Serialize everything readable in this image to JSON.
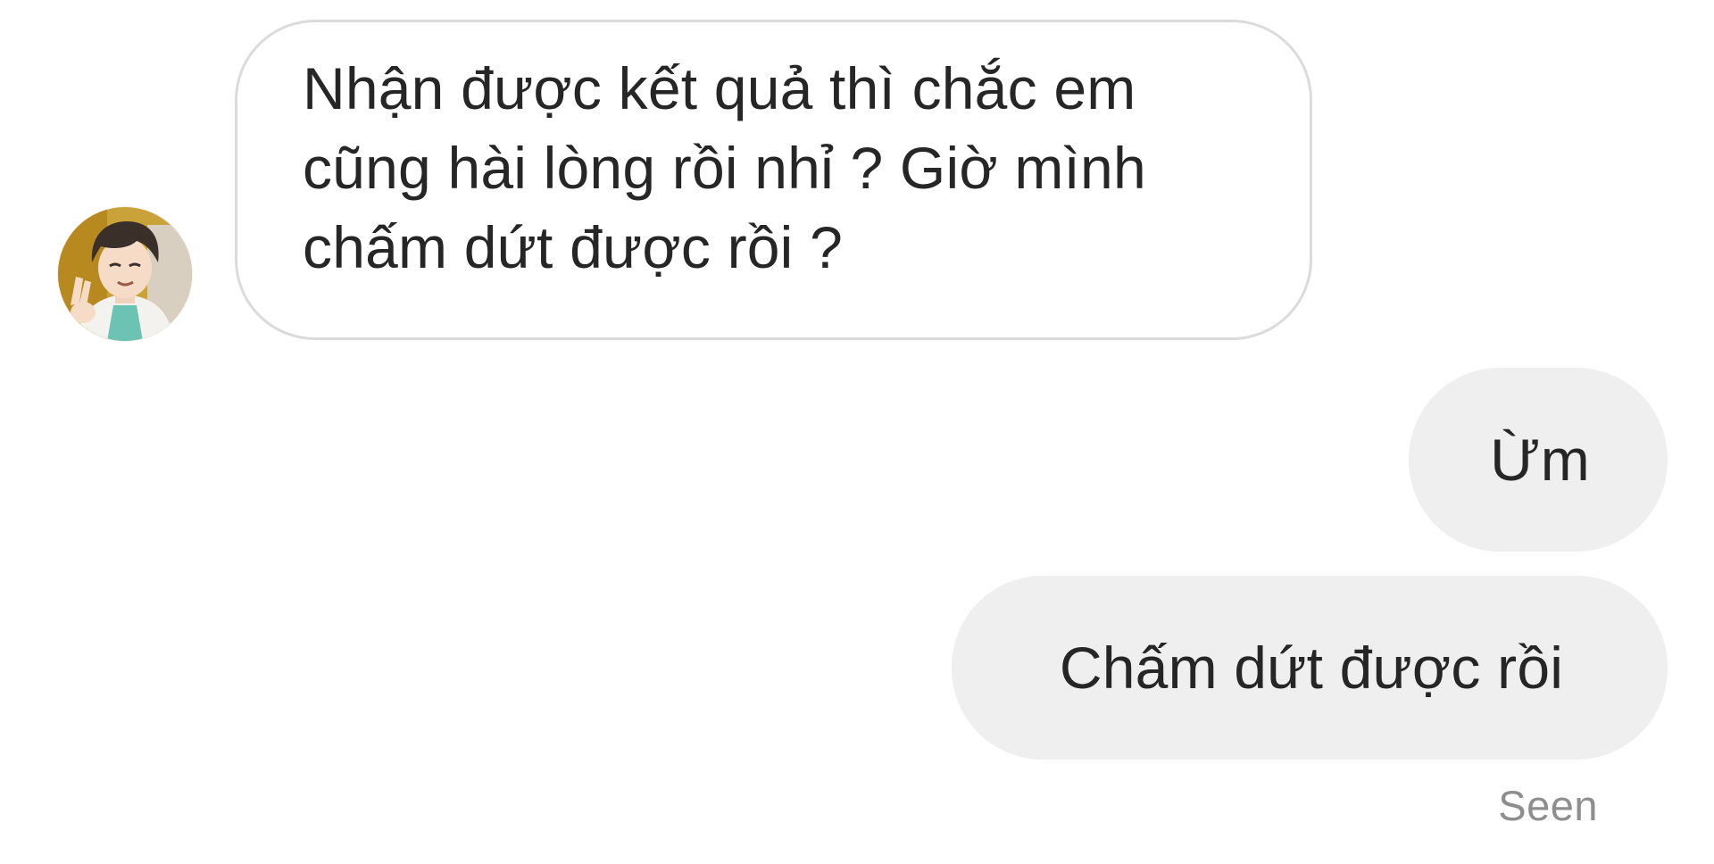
{
  "conversation": {
    "contact_avatar_icon": "user-avatar-anime-character",
    "messages": [
      {
        "direction": "received",
        "text": "Nhận được kết quả thì chắc em cũng hài lòng rồi nhỉ ? Giờ mình chấm dứt được rồi ?"
      },
      {
        "direction": "sent",
        "text": "Ừm"
      },
      {
        "direction": "sent",
        "text": "Chấm dứt được rồi"
      }
    ],
    "status": "Seen"
  },
  "colors": {
    "received_bubble_border": "#dbdbdb",
    "sent_bubble_background": "#efefef",
    "text": "#262626",
    "status_text": "#8e8e8e"
  }
}
